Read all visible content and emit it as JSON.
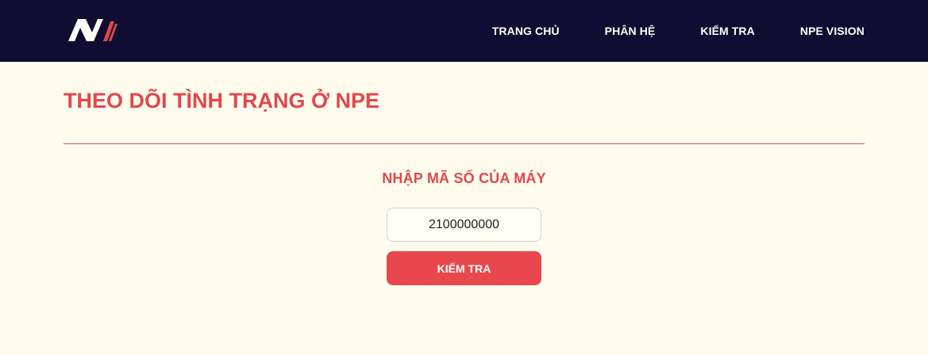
{
  "colors": {
    "navbar_bg": "#0f0e32",
    "page_bg": "#fffcee",
    "accent": "#e2474c",
    "button_bg": "#e8474d"
  },
  "navbar": {
    "logo_icon": "npe-logo-icon",
    "links": [
      {
        "label": "TRANG CHỦ"
      },
      {
        "label": "PHÂN HỆ"
      },
      {
        "label": "KIỂM TRA"
      },
      {
        "label": "NPE VISION"
      }
    ]
  },
  "main": {
    "title": "THEO DÕI TÌNH TRẠNG Ở NPE",
    "form": {
      "label": "NHẬP MÃ SỐ CỦA MÁY",
      "code_value": "2100000000",
      "submit_label": "KIỂM TRA"
    }
  }
}
